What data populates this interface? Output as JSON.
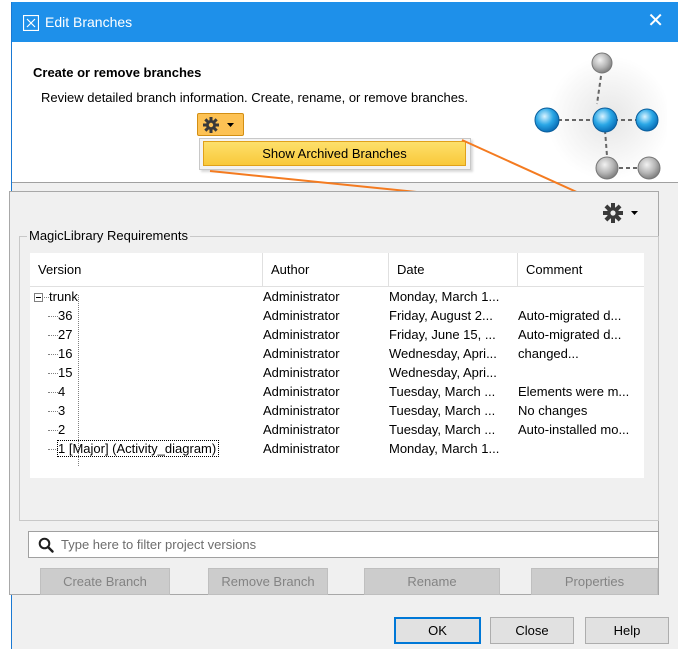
{
  "window": {
    "title": "Edit Branches",
    "close_glyph": "✕",
    "title_bg": "#1e90ea"
  },
  "header": {
    "heading": "Create or remove branches",
    "description": "Review detailed branch information. Create, rename, or remove branches."
  },
  "popup_menu": {
    "item": "Show Archived Branches"
  },
  "group": {
    "title": "MagicLibrary Requirements"
  },
  "table": {
    "columns": [
      "Version",
      "Author",
      "Date",
      "Comment"
    ],
    "rows": [
      {
        "version": "trunk",
        "author": "Administrator",
        "date": "Monday, March 1...",
        "comment": ""
      },
      {
        "version": "36",
        "author": "Administrator",
        "date": "Friday, August 2...",
        "comment": "Auto-migrated d..."
      },
      {
        "version": "27",
        "author": "Administrator",
        "date": "Friday, June 15, ...",
        "comment": "Auto-migrated d..."
      },
      {
        "version": "16",
        "author": "Administrator",
        "date": "Wednesday, Apri...",
        "comment": "changed..."
      },
      {
        "version": "15",
        "author": "Administrator",
        "date": "Wednesday, Apri...",
        "comment": ""
      },
      {
        "version": "4",
        "author": "Administrator",
        "date": "Tuesday, March ...",
        "comment": "Elements were m..."
      },
      {
        "version": "3",
        "author": "Administrator",
        "date": "Tuesday, March ...",
        "comment": "No changes"
      },
      {
        "version": "2",
        "author": "Administrator",
        "date": "Tuesday, March ...",
        "comment": "Auto-installed mo..."
      },
      {
        "version": "1 [Major] (Activity_diagram)",
        "author": "Administrator",
        "date": "Monday, March 1...",
        "comment": ""
      }
    ]
  },
  "filter": {
    "placeholder": "Type here to filter project versions",
    "icon": "search-icon"
  },
  "actions": {
    "create_branch": "Create Branch",
    "remove_branch": "Remove Branch",
    "rename": "Rename",
    "properties": "Properties"
  },
  "dialog_buttons": {
    "ok": "OK",
    "close": "Close",
    "help": "Help"
  },
  "colors": {
    "accent_orange": "#f47b20",
    "gear_button": "#fdc254",
    "menu_item": "#f9c93a"
  }
}
